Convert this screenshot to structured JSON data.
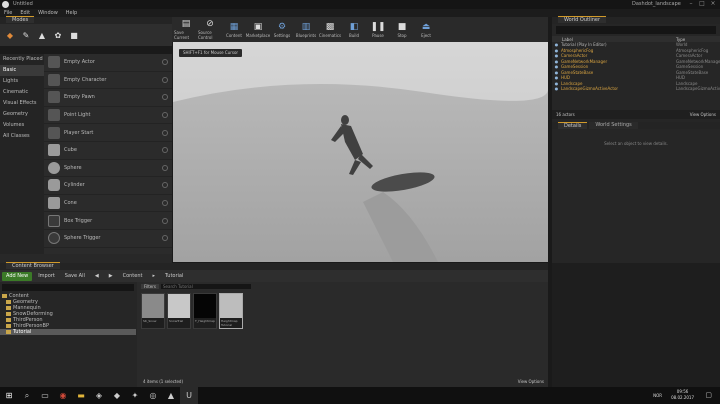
{
  "window": {
    "tab_title": "Untitled",
    "project_title": "Dashdot_landscape"
  },
  "menu": [
    "File",
    "Edit",
    "Window",
    "Help"
  ],
  "modes_panel": {
    "tab": "Modes",
    "categories": [
      "Recently Placed",
      "Basic",
      "Lights",
      "Cinematic",
      "Visual Effects",
      "Geometry",
      "Volumes",
      "All Classes"
    ],
    "selected_category": "Basic",
    "items": [
      "Empty Actor",
      "Empty Character",
      "Empty Pawn",
      "Point Light",
      "Player Start",
      "Cube",
      "Sphere",
      "Cylinder",
      "Cone",
      "Box Trigger",
      "Sphere Trigger"
    ]
  },
  "toolbar": [
    {
      "label": "Save Current",
      "icon": "save-icon"
    },
    {
      "label": "Source Control",
      "icon": "source-control-icon"
    },
    {
      "label": "Content",
      "icon": "content-icon"
    },
    {
      "label": "Marketplace",
      "icon": "marketplace-icon"
    },
    {
      "label": "Settings",
      "icon": "settings-icon"
    },
    {
      "label": "Blueprints",
      "icon": "blueprints-icon"
    },
    {
      "label": "Cinematics",
      "icon": "cinematics-icon"
    },
    {
      "label": "Build",
      "icon": "build-icon"
    },
    {
      "label": "Pause",
      "icon": "pause-icon"
    },
    {
      "label": "Stop",
      "icon": "stop-icon"
    },
    {
      "label": "Eject",
      "icon": "eject-icon"
    }
  ],
  "viewport": {
    "hint": "SHIFT+F1 for Mouse Cursor"
  },
  "outliner": {
    "tab": "World Outliner",
    "col_label": "Label",
    "col_type": "Type",
    "rows": [
      {
        "name": "Tutorial (Play In Editor)",
        "type": "World"
      },
      {
        "name": "AtmosphericFog",
        "type": "AtmosphericFog"
      },
      {
        "name": "CameraActor",
        "type": "CameraActor"
      },
      {
        "name": "GameNetworkManager",
        "type": "GameNetworkManager"
      },
      {
        "name": "GameSession",
        "type": "GameSession"
      },
      {
        "name": "GameStateBase",
        "type": "GameStateBase"
      },
      {
        "name": "HUD",
        "type": "HUD"
      },
      {
        "name": "Landscape",
        "type": "Landscape"
      },
      {
        "name": "LandscapeGizmoActiveActor",
        "type": "LandscapeGizmoActive"
      }
    ],
    "actor_count": "16 actors",
    "view_options": "View Options"
  },
  "details": {
    "tab_details": "Details",
    "tab_world": "World Settings",
    "hint": "Select an object to view details."
  },
  "content_browser": {
    "tab": "Content Browser",
    "add_new": "Add New",
    "import": "Import",
    "save_all": "Save All",
    "path": [
      "Content",
      "Tutorial"
    ],
    "filters": "Filters",
    "search_placeholder": "Search Tutorial",
    "folders": [
      "Content",
      "Geometry",
      "Mannequin",
      "SnowDeforming",
      "ThirdPerson",
      "ThirdPersonBP",
      "Tutorial"
    ],
    "selected_folder": "Tutorial",
    "assets": [
      {
        "name": "SK_Snow",
        "color": "#8a8a8a"
      },
      {
        "name": "SnowTrail",
        "color": "#c8c8c8"
      },
      {
        "name": "T_Heightmap",
        "color": "#050505"
      },
      {
        "name": "Heightmap Tutorial",
        "color": "#bdbdbd"
      }
    ],
    "status": "4 items (1 selected)",
    "view_options": "View Options"
  },
  "taskbar": {
    "lang": "NOR",
    "time": "09:56",
    "date": "08.02.2017"
  },
  "colors": {
    "accent_gold": "#d19a2a",
    "add_new_green": "#3b7a27",
    "folder": "#c9a64a"
  }
}
